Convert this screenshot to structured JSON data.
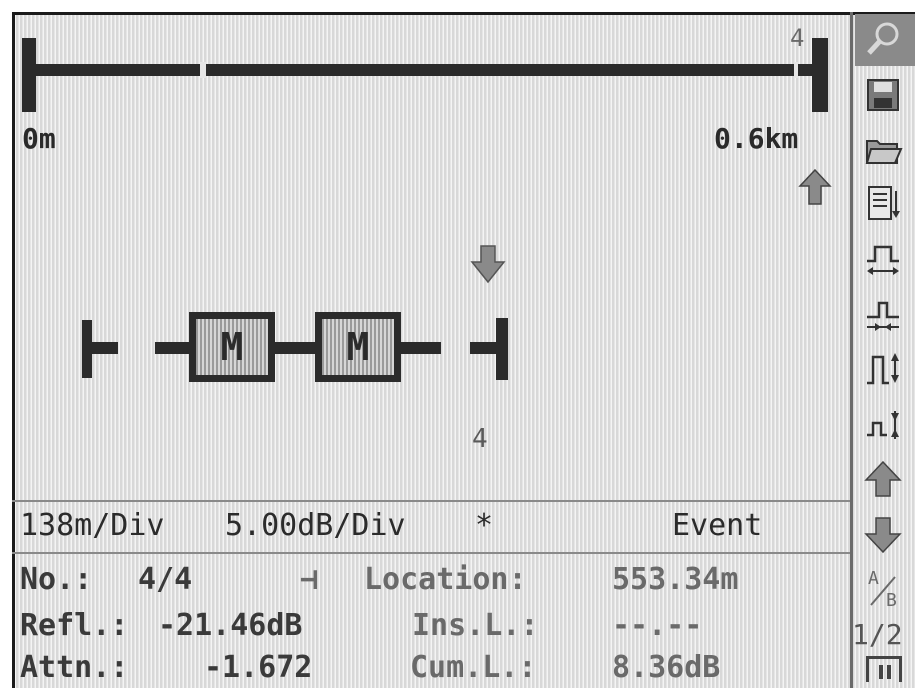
{
  "overview": {
    "start_label": "0m",
    "end_label": "0.6km",
    "event_marker": "4"
  },
  "event_map": {
    "boxes": [
      "M",
      "M"
    ],
    "end_event_label": "4"
  },
  "status_bar": {
    "horizontal_scale": "138m/Div",
    "vertical_scale": "5.00dB/Div",
    "marker": "*",
    "mode": "Event"
  },
  "event_info": {
    "number_label": "No.:",
    "number_value": "4/4",
    "event_type_symbol": "⊣",
    "location_label": "Location:",
    "location_value": "553.34m",
    "reflectance_label": "Refl.:",
    "reflectance_value": "-21.46dB",
    "insertion_loss_label": "Ins.L.:",
    "insertion_loss_value": "--.--",
    "attenuation_label": "Attn.:",
    "attenuation_value": "-1.672",
    "cumulative_loss_label": "Cum.L.:",
    "cumulative_loss_value": "8.36dB"
  },
  "toolbar": {
    "ab_label_a": "A",
    "ab_label_b": "B",
    "page_indicator": "1/2",
    "icons": [
      "zoom-icon",
      "save-icon",
      "open-folder-icon",
      "report-icon",
      "pulse-widen-icon",
      "pulse-narrow-icon",
      "pulse-up-icon",
      "pulse-down-icon",
      "arrow-up-icon",
      "arrow-down-icon",
      "ab-cursor-icon",
      "page-icon"
    ]
  },
  "colors": {
    "background": "#e6e6e6",
    "foreground": "#2b2b2b",
    "dim_text": "#6a6a6a"
  }
}
